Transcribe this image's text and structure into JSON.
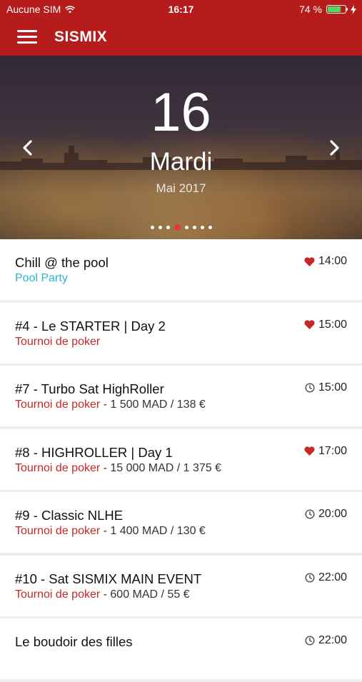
{
  "status_bar": {
    "carrier": "Aucune SIM",
    "time": "16:17",
    "battery": "74 %",
    "battery_level": 0.74
  },
  "app_bar": {
    "title": "SISMIX",
    "menu_icon": "hamburger-menu-icon"
  },
  "hero": {
    "day": "16",
    "weekday": "Mardi",
    "month_year": "Mai 2017",
    "prev_icon": "chevron-left-icon",
    "next_icon": "chevron-right-icon",
    "page_count": 8,
    "active_page": 4
  },
  "colors": {
    "brand_red": "#b71c1c",
    "category_red": "#c62828",
    "teal": "#29b6d6",
    "heart": "#c62828",
    "active_dot": "#e53935"
  },
  "events": [
    {
      "title": "Chill @ the pool",
      "category": "Pool Party",
      "category_style": "teal",
      "price": "",
      "icon": "heart-icon",
      "time": "14:00"
    },
    {
      "title": "#4 - Le STARTER | Day 2",
      "category": "Tournoi de poker",
      "category_style": "red",
      "price": "",
      "icon": "heart-icon",
      "time": "15:00"
    },
    {
      "title": "#7 - Turbo Sat HighRoller",
      "category": "Tournoi de poker",
      "category_style": "red",
      "price": " - 1 500 MAD / 138 €",
      "icon": "clock-icon",
      "time": "15:00"
    },
    {
      "title": "#8 - HIGHROLLER | Day 1",
      "category": "Tournoi de poker",
      "category_style": "red",
      "price": " - 15 000 MAD / 1 375 €",
      "icon": "heart-icon",
      "time": "17:00"
    },
    {
      "title": "#9 - Classic NLHE",
      "category": "Tournoi de poker",
      "category_style": "red",
      "price": " - 1 400 MAD / 130 €",
      "icon": "clock-icon",
      "time": "20:00"
    },
    {
      "title": "#10 - Sat SISMIX MAIN EVENT",
      "category": "Tournoi de poker",
      "category_style": "red",
      "price": " - 600 MAD / 55 €",
      "icon": "clock-icon",
      "time": "22:00"
    },
    {
      "title": "Le boudoir des filles",
      "category": "",
      "category_style": "red",
      "price": "",
      "icon": "clock-icon",
      "time": "22:00"
    }
  ]
}
